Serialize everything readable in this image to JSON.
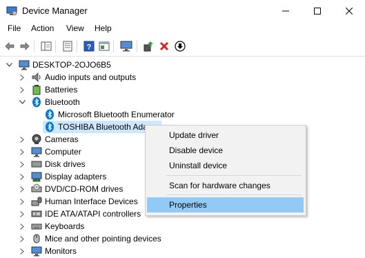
{
  "window": {
    "title": "Device Manager",
    "minimize_glyph": "—",
    "maximize_glyph": "☐",
    "close_glyph": "✕"
  },
  "menu": [
    "File",
    "Action",
    "View",
    "Help"
  ],
  "toolbar": {
    "icons": [
      "back-arrow-icon",
      "forward-arrow-icon",
      "show-hide-console-tree-icon",
      "properties-icon",
      "help-icon",
      "view-icon",
      "monitor-icon",
      "update-driver-icon",
      "uninstall-icon",
      "download-icon"
    ]
  },
  "tree": {
    "root": "DESKTOP-2OJO6B5",
    "items": [
      {
        "label": "Audio inputs and outputs",
        "expanded": false
      },
      {
        "label": "Batteries",
        "expanded": false
      },
      {
        "label": "Bluetooth",
        "expanded": true
      },
      {
        "label": "Microsoft Bluetooth Enumerator",
        "child": true
      },
      {
        "label": "TOSHIBA Bluetooth Adap",
        "child": true,
        "selected": true
      },
      {
        "label": "Cameras",
        "expanded": false
      },
      {
        "label": "Computer",
        "expanded": false
      },
      {
        "label": "Disk drives",
        "expanded": false
      },
      {
        "label": "Display adapters",
        "expanded": false
      },
      {
        "label": "DVD/CD-ROM drives",
        "expanded": false
      },
      {
        "label": "Human Interface Devices",
        "expanded": false
      },
      {
        "label": "IDE ATA/ATAPI controllers",
        "expanded": false
      },
      {
        "label": "Keyboards",
        "expanded": false
      },
      {
        "label": "Mice and other pointing devices",
        "expanded": false
      },
      {
        "label": "Monitors",
        "expanded": false
      }
    ]
  },
  "context_menu": {
    "update_driver": "Update driver",
    "disable_device": "Disable device",
    "uninstall_device": "Uninstall device",
    "scan": "Scan for hardware changes",
    "properties": "Properties"
  },
  "colors": {
    "selection": "#cce8ff",
    "menu_highlight": "#91c9f7",
    "bluetooth_blue": "#0078d7"
  }
}
